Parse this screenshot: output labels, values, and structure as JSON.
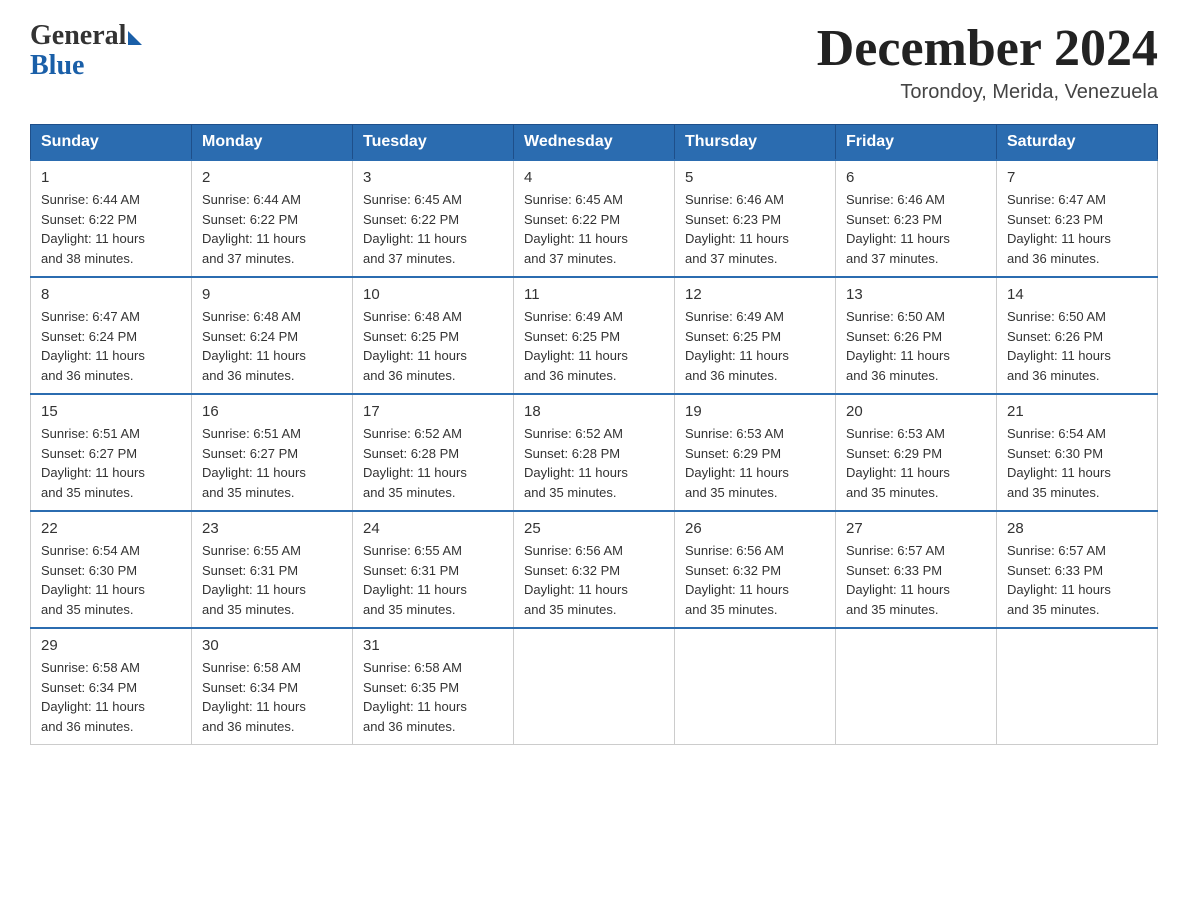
{
  "header": {
    "logo_general": "General",
    "logo_blue": "Blue",
    "month_title": "December 2024",
    "location": "Torondoy, Merida, Venezuela"
  },
  "days_of_week": [
    "Sunday",
    "Monday",
    "Tuesday",
    "Wednesday",
    "Thursday",
    "Friday",
    "Saturday"
  ],
  "weeks": [
    [
      {
        "day": "1",
        "sunrise": "6:44 AM",
        "sunset": "6:22 PM",
        "daylight": "11 hours and 38 minutes."
      },
      {
        "day": "2",
        "sunrise": "6:44 AM",
        "sunset": "6:22 PM",
        "daylight": "11 hours and 37 minutes."
      },
      {
        "day": "3",
        "sunrise": "6:45 AM",
        "sunset": "6:22 PM",
        "daylight": "11 hours and 37 minutes."
      },
      {
        "day": "4",
        "sunrise": "6:45 AM",
        "sunset": "6:22 PM",
        "daylight": "11 hours and 37 minutes."
      },
      {
        "day": "5",
        "sunrise": "6:46 AM",
        "sunset": "6:23 PM",
        "daylight": "11 hours and 37 minutes."
      },
      {
        "day": "6",
        "sunrise": "6:46 AM",
        "sunset": "6:23 PM",
        "daylight": "11 hours and 37 minutes."
      },
      {
        "day": "7",
        "sunrise": "6:47 AM",
        "sunset": "6:23 PM",
        "daylight": "11 hours and 36 minutes."
      }
    ],
    [
      {
        "day": "8",
        "sunrise": "6:47 AM",
        "sunset": "6:24 PM",
        "daylight": "11 hours and 36 minutes."
      },
      {
        "day": "9",
        "sunrise": "6:48 AM",
        "sunset": "6:24 PM",
        "daylight": "11 hours and 36 minutes."
      },
      {
        "day": "10",
        "sunrise": "6:48 AM",
        "sunset": "6:25 PM",
        "daylight": "11 hours and 36 minutes."
      },
      {
        "day": "11",
        "sunrise": "6:49 AM",
        "sunset": "6:25 PM",
        "daylight": "11 hours and 36 minutes."
      },
      {
        "day": "12",
        "sunrise": "6:49 AM",
        "sunset": "6:25 PM",
        "daylight": "11 hours and 36 minutes."
      },
      {
        "day": "13",
        "sunrise": "6:50 AM",
        "sunset": "6:26 PM",
        "daylight": "11 hours and 36 minutes."
      },
      {
        "day": "14",
        "sunrise": "6:50 AM",
        "sunset": "6:26 PM",
        "daylight": "11 hours and 36 minutes."
      }
    ],
    [
      {
        "day": "15",
        "sunrise": "6:51 AM",
        "sunset": "6:27 PM",
        "daylight": "11 hours and 35 minutes."
      },
      {
        "day": "16",
        "sunrise": "6:51 AM",
        "sunset": "6:27 PM",
        "daylight": "11 hours and 35 minutes."
      },
      {
        "day": "17",
        "sunrise": "6:52 AM",
        "sunset": "6:28 PM",
        "daylight": "11 hours and 35 minutes."
      },
      {
        "day": "18",
        "sunrise": "6:52 AM",
        "sunset": "6:28 PM",
        "daylight": "11 hours and 35 minutes."
      },
      {
        "day": "19",
        "sunrise": "6:53 AM",
        "sunset": "6:29 PM",
        "daylight": "11 hours and 35 minutes."
      },
      {
        "day": "20",
        "sunrise": "6:53 AM",
        "sunset": "6:29 PM",
        "daylight": "11 hours and 35 minutes."
      },
      {
        "day": "21",
        "sunrise": "6:54 AM",
        "sunset": "6:30 PM",
        "daylight": "11 hours and 35 minutes."
      }
    ],
    [
      {
        "day": "22",
        "sunrise": "6:54 AM",
        "sunset": "6:30 PM",
        "daylight": "11 hours and 35 minutes."
      },
      {
        "day": "23",
        "sunrise": "6:55 AM",
        "sunset": "6:31 PM",
        "daylight": "11 hours and 35 minutes."
      },
      {
        "day": "24",
        "sunrise": "6:55 AM",
        "sunset": "6:31 PM",
        "daylight": "11 hours and 35 minutes."
      },
      {
        "day": "25",
        "sunrise": "6:56 AM",
        "sunset": "6:32 PM",
        "daylight": "11 hours and 35 minutes."
      },
      {
        "day": "26",
        "sunrise": "6:56 AM",
        "sunset": "6:32 PM",
        "daylight": "11 hours and 35 minutes."
      },
      {
        "day": "27",
        "sunrise": "6:57 AM",
        "sunset": "6:33 PM",
        "daylight": "11 hours and 35 minutes."
      },
      {
        "day": "28",
        "sunrise": "6:57 AM",
        "sunset": "6:33 PM",
        "daylight": "11 hours and 35 minutes."
      }
    ],
    [
      {
        "day": "29",
        "sunrise": "6:58 AM",
        "sunset": "6:34 PM",
        "daylight": "11 hours and 36 minutes."
      },
      {
        "day": "30",
        "sunrise": "6:58 AM",
        "sunset": "6:34 PM",
        "daylight": "11 hours and 36 minutes."
      },
      {
        "day": "31",
        "sunrise": "6:58 AM",
        "sunset": "6:35 PM",
        "daylight": "11 hours and 36 minutes."
      },
      null,
      null,
      null,
      null
    ]
  ],
  "labels": {
    "sunrise": "Sunrise:",
    "sunset": "Sunset:",
    "daylight": "Daylight:"
  }
}
